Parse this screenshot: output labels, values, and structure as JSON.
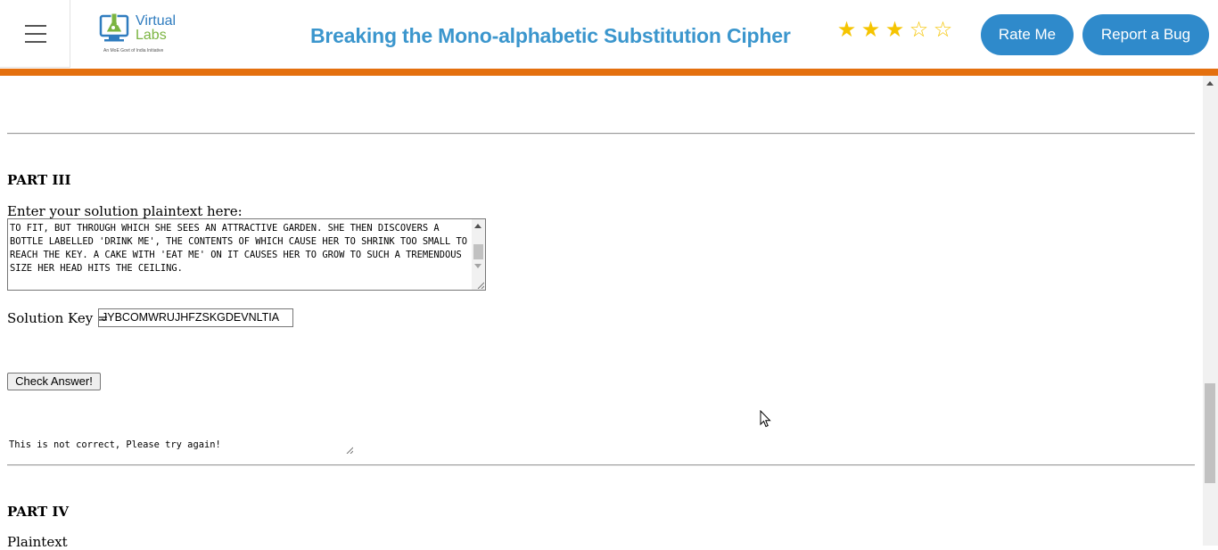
{
  "header": {
    "logo": {
      "name": "Virtual",
      "sub": "Labs",
      "tagline": "An MoE Govt of India Initiative"
    },
    "title": "Breaking the Mono-alphabetic Substitution Cipher",
    "rating": {
      "value": 3,
      "max": 5,
      "filled_star": "★",
      "empty_star": "☆"
    },
    "rate_button": "Rate Me",
    "bug_button": "Report a Bug",
    "accent_color": "#e4700f",
    "brand_color": "#2f8acb"
  },
  "part3": {
    "heading": "PART III",
    "prompt": "Enter your solution plaintext here:",
    "plaintext": "TO FIT, BUT THROUGH WHICH SHE SEES AN ATTRACTIVE GARDEN. SHE THEN DISCOVERS A BOTTLE LABELLED 'DRINK ME', THE CONTENTS OF WHICH CAUSE HER TO SHRINK TOO SMALL TO REACH THE KEY. A CAKE WITH 'EAT ME' ON IT CAUSES HER TO GROW TO SUCH A TREMENDOUS SIZE HER HEAD HITS THE CEILING.",
    "key_label": "Solution Key =",
    "key_value": "JYBCOMWRUJHFZSKGDEVNLTIA",
    "check_button": "Check Answer!",
    "result": "This is not correct, Please try again!"
  },
  "part4": {
    "heading": "PART IV",
    "label": "Plaintext"
  }
}
